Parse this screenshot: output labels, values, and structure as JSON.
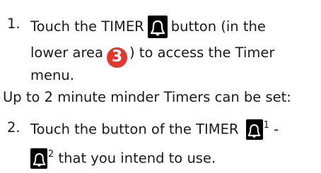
{
  "steps": [
    {
      "number": "1.",
      "line1_before": "Touch the TIMER",
      "line1_icon": "bell-icon",
      "line1_after": "button (in the",
      "line2_before": "lower area",
      "line2_badge": "3",
      "line2_after": ") to access the Timer",
      "line3": "menu."
    },
    {
      "number": "2.",
      "line1_before": "Touch the button of the TIMER",
      "line1_icon": "bell-icon",
      "line1_sup": "1",
      "line1_dash": "-",
      "line2_icon": "bell-icon",
      "line2_sup": "2",
      "line2_after": "that you intend to use."
    }
  ],
  "note": "Up to 2 minute minder Timers can be set:",
  "colors": {
    "badge": "#e8352a",
    "icon_bg": "#000000",
    "icon_fg": "#ffffff"
  }
}
